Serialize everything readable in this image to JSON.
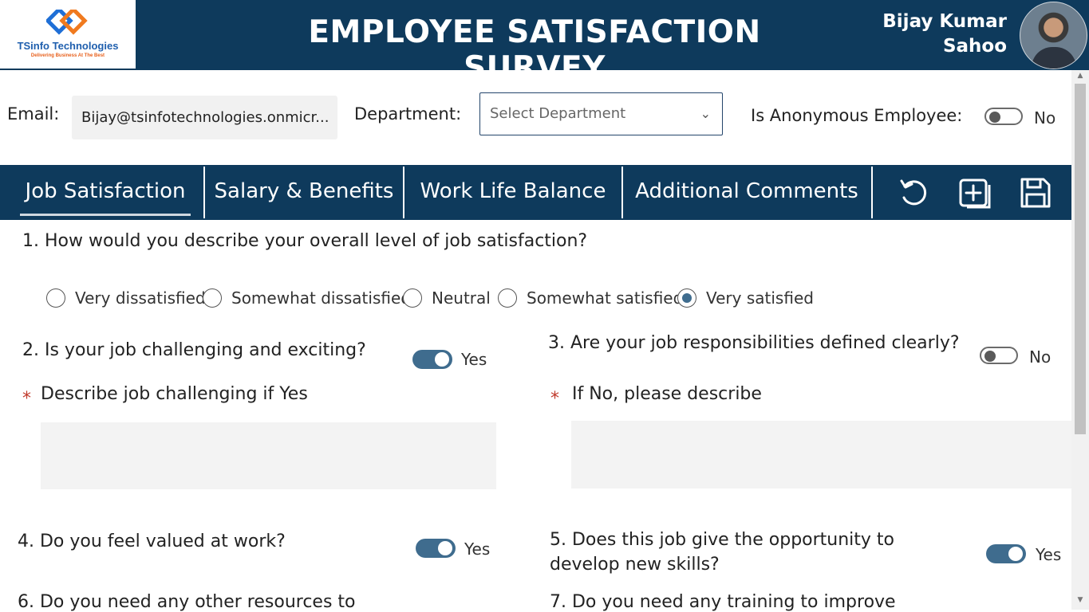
{
  "header": {
    "logo_name": "TSinfo Technologies",
    "logo_tagline": "Delivering Business At The Best",
    "title": "EMPLOYEE SATISFACTION SURVEY",
    "user_name_line1": "Bijay Kumar",
    "user_name_line2": "Sahoo"
  },
  "form": {
    "email_label": "Email:",
    "email_value": "Bijay@tsinfotechnologies.onmicr...",
    "department_label": "Department:",
    "department_placeholder": "Select Department",
    "anonymous_label": "Is Anonymous Employee:",
    "anonymous_value": "No"
  },
  "tabs": [
    {
      "label": "Job Satisfaction",
      "active": true
    },
    {
      "label": "Salary & Benefits"
    },
    {
      "label": "Work Life Balance"
    },
    {
      "label": "Additional Comments"
    }
  ],
  "toolbar_icons": [
    "reset-icon",
    "add-new-icon",
    "save-icon"
  ],
  "questions": {
    "q1": {
      "text": "1. How would you describe your overall level of job satisfaction?",
      "options": [
        "Very dissatisfied",
        "Somewhat dissatisfied",
        "Neutral",
        "Somewhat satisfied",
        "Very satisfied"
      ],
      "selected": "Very satisfied"
    },
    "q2": {
      "text": "2. Is your job challenging and exciting?",
      "value": "Yes",
      "detail_label": "Describe job challenging if Yes"
    },
    "q3": {
      "text": "3. Are your job responsibilities defined clearly?",
      "value": "No",
      "detail_label": "If No, please describe"
    },
    "q4": {
      "text": "4. Do you feel valued at work?",
      "value": "Yes"
    },
    "q5": {
      "text_line1": "5. Does this job give the opportunity to",
      "text_line2": "develop new skills?",
      "value": "Yes"
    },
    "q6": {
      "text": "6. Do you need any other resources to"
    },
    "q7": {
      "text": "7. Do you need any training to improve"
    }
  },
  "required_marker": "*",
  "colors": {
    "header_bg": "#0e3a5c",
    "accent": "#3f6c8e",
    "required": "#c0392b"
  }
}
